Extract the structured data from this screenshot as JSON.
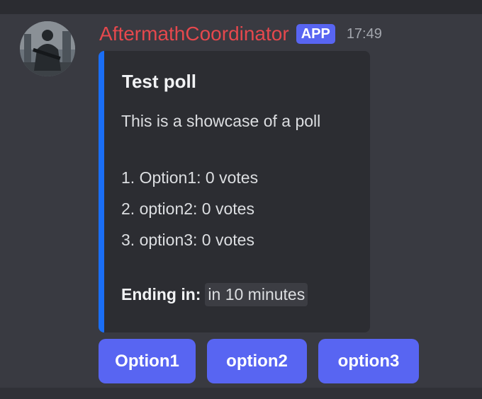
{
  "message": {
    "author": "AftermathCoordinator",
    "badge": "APP",
    "timestamp": "17:49",
    "avatar_icon": "soldier-avatar-icon",
    "colors": {
      "username": "#e5484d",
      "badge": "#5865f2",
      "embed_accent": "#1a6ef6",
      "button": "#5865f2"
    }
  },
  "embed": {
    "title": "Test poll",
    "description": "This is a showcase of a poll",
    "options": [
      "1. Option1: 0 votes",
      "2. option2: 0 votes",
      "3. option3: 0 votes"
    ],
    "ending_label": "Ending in:",
    "ending_value": "in 10 minutes"
  },
  "buttons": [
    "Option1",
    "option2",
    "option3"
  ]
}
